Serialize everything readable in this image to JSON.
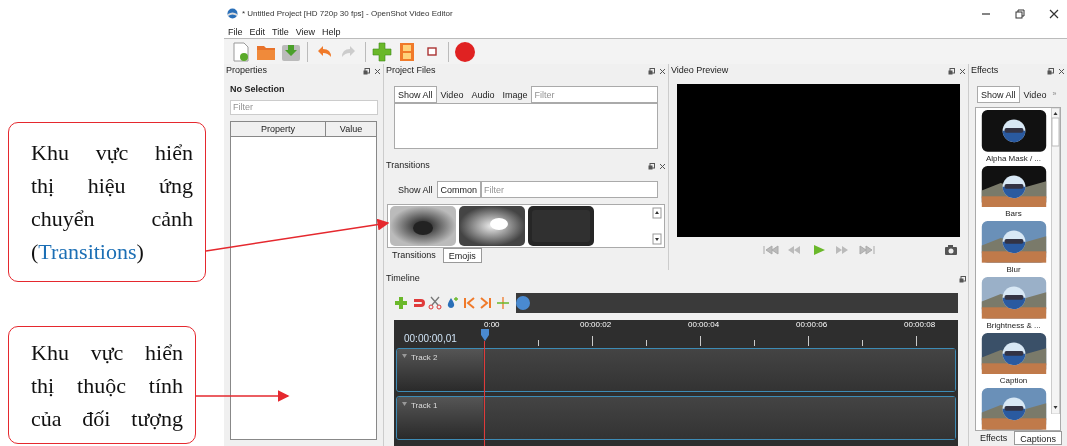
{
  "callouts": [
    {
      "lines": [
        [
          {
            "text": "Khu vực hiển",
            "accent": false
          }
        ],
        [
          {
            "text": "thị hiệu ứng",
            "accent": false
          }
        ],
        [
          {
            "text": "chuyển cảnh",
            "accent": false
          }
        ],
        [
          {
            "text": "(",
            "accent": false
          },
          {
            "text": "Transitions",
            "accent": true
          },
          {
            "text": ")",
            "accent": false
          }
        ]
      ]
    },
    {
      "lines": [
        [
          {
            "text": "Khu vực hiển",
            "accent": false
          }
        ],
        [
          {
            "text": "thị thuộc tính",
            "accent": false
          }
        ],
        [
          {
            "text": "của đối tượng",
            "accent": false
          }
        ]
      ]
    }
  ],
  "window": {
    "title": "* Untitled Project [HD 720p 30 fps] - OpenShot Video Editor"
  },
  "menu": [
    "File",
    "Edit",
    "Title",
    "View",
    "Help"
  ],
  "properties": {
    "title": "Properties",
    "selection": "No Selection",
    "filter_placeholder": "Filter",
    "columns": [
      "Property",
      "Value"
    ]
  },
  "project_files": {
    "title": "Project Files",
    "tabs": [
      {
        "label": "Show All",
        "selected": true
      },
      {
        "label": "Video",
        "selected": false
      },
      {
        "label": "Audio",
        "selected": false
      },
      {
        "label": "Image",
        "selected": false
      }
    ],
    "filter_placeholder": "Filter"
  },
  "transitions": {
    "title": "Transitions",
    "tabs": [
      {
        "label": "Show All",
        "selected": false
      },
      {
        "label": "Common",
        "selected": true
      }
    ],
    "filter_placeholder": "Filter",
    "bottom_tabs": [
      {
        "label": "Transitions",
        "selected": true
      },
      {
        "label": "Emojis",
        "selected": false
      }
    ]
  },
  "video_preview": {
    "title": "Video Preview"
  },
  "effects": {
    "title": "Effects",
    "tabs": [
      {
        "label": "Show All",
        "selected": true
      },
      {
        "label": "Video",
        "selected": false
      }
    ],
    "more": "»",
    "items": [
      "Alpha Mask / ...",
      "Bars",
      "Blur",
      "Brightness & ...",
      "Caption"
    ],
    "bottom_tabs": [
      {
        "label": "Effects",
        "selected": true
      },
      {
        "label": "Captions",
        "selected": false
      }
    ]
  },
  "timeline": {
    "title": "Timeline",
    "timecode": "00:00:00,01",
    "ticks": [
      "0:00",
      "00:00:02",
      "00:00:04",
      "00:00:06",
      "00:00:08"
    ],
    "tracks": [
      "Track 2",
      "Track 1"
    ]
  }
}
